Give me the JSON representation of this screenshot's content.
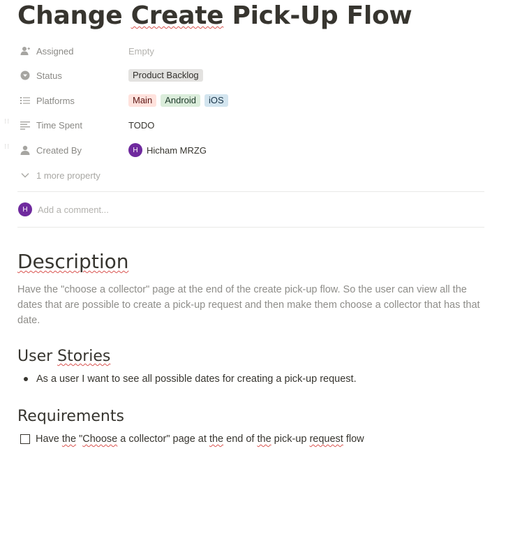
{
  "page": {
    "title_parts": [
      "Change ",
      "Create",
      " Pick-Up Flow"
    ]
  },
  "properties": [
    {
      "key": "Assigned",
      "icon": "person-add-icon",
      "value": "Empty"
    },
    {
      "key": "Status",
      "icon": "status-chevron-icon",
      "value": "Product Backlog"
    },
    {
      "key": "Platforms",
      "icon": "list-icon",
      "values": [
        "Main",
        "Android",
        "iOS"
      ]
    },
    {
      "key": "Time Spent",
      "icon": "text-lines-icon",
      "value": "TODO"
    },
    {
      "key": "Created By",
      "icon": "person-icon",
      "avatar_initial": "H",
      "value": "Hicham MRZG"
    }
  ],
  "more_properties_label": "1 more property",
  "comment": {
    "avatar_initial": "H",
    "placeholder": "Add a comment..."
  },
  "content": {
    "description_heading": "Description",
    "description_text": "Have the \"choose a collector\" page at the end of the create pick-up flow. So the user can view all the dates that are possible to create a pick-up request and then make them choose a collector that has that date.",
    "user_stories_heading_parts": [
      "User ",
      "Stories"
    ],
    "user_stories": [
      "As a user I want to see all possible dates for creating a pick-up request."
    ],
    "requirements_heading": "Requirements",
    "requirement_parts": [
      "Have ",
      "the",
      " \"",
      "Choose",
      " a collector\" page at ",
      "the",
      " end of ",
      "the",
      " pick-up ",
      "request",
      " flow"
    ]
  },
  "colors": {
    "avatar": "#6f2a9e",
    "tag_status": "#e3e2e0",
    "tag_main": "#ffe2dd",
    "tag_android": "#dbeddb",
    "tag_ios": "#d3e5ef",
    "spellcheck_underline": "#d9534f"
  }
}
